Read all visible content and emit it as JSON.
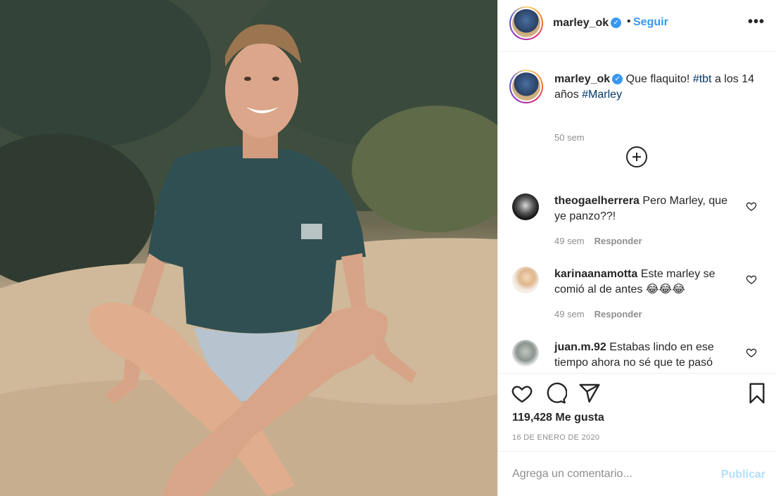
{
  "post": {
    "username": "marley_ok",
    "verified_icon": "verified-badge-icon",
    "separator": "•",
    "follow_label": "Seguir",
    "more_label": "•••",
    "caption_text": "Que flaquito!",
    "caption_tag_1": "#tbt",
    "caption_mid": "a los 14 años",
    "caption_tag_2": "#Marley",
    "caption_time": "50 sem",
    "likes": "119,428 Me gusta",
    "date": "16 DE ENERO DE 2020"
  },
  "comments": [
    {
      "username": "theogaelherrera",
      "text": "Pero Marley, que ye panzo??!",
      "time": "49 sem",
      "reply": "Responder"
    },
    {
      "username": "karinaanamotta",
      "text": "Este marley se comió al de antes 😂😂😂",
      "time": "49 sem",
      "reply": "Responder"
    },
    {
      "username": "juan.m.92",
      "text": "Estabas lindo en ese tiempo ahora no sé que te pasó",
      "time": "",
      "reply": ""
    }
  ],
  "composer": {
    "placeholder": "Agrega un comentario...",
    "post_label": "Publicar"
  },
  "colors": {
    "accent": "#3897f0",
    "text": "#262626",
    "muted": "#8e8e8e",
    "post_disabled": "#b2dffc"
  },
  "icons": [
    "heart-icon",
    "comment-icon",
    "share-icon",
    "bookmark-icon",
    "plus-circle-icon",
    "more-icon"
  ]
}
